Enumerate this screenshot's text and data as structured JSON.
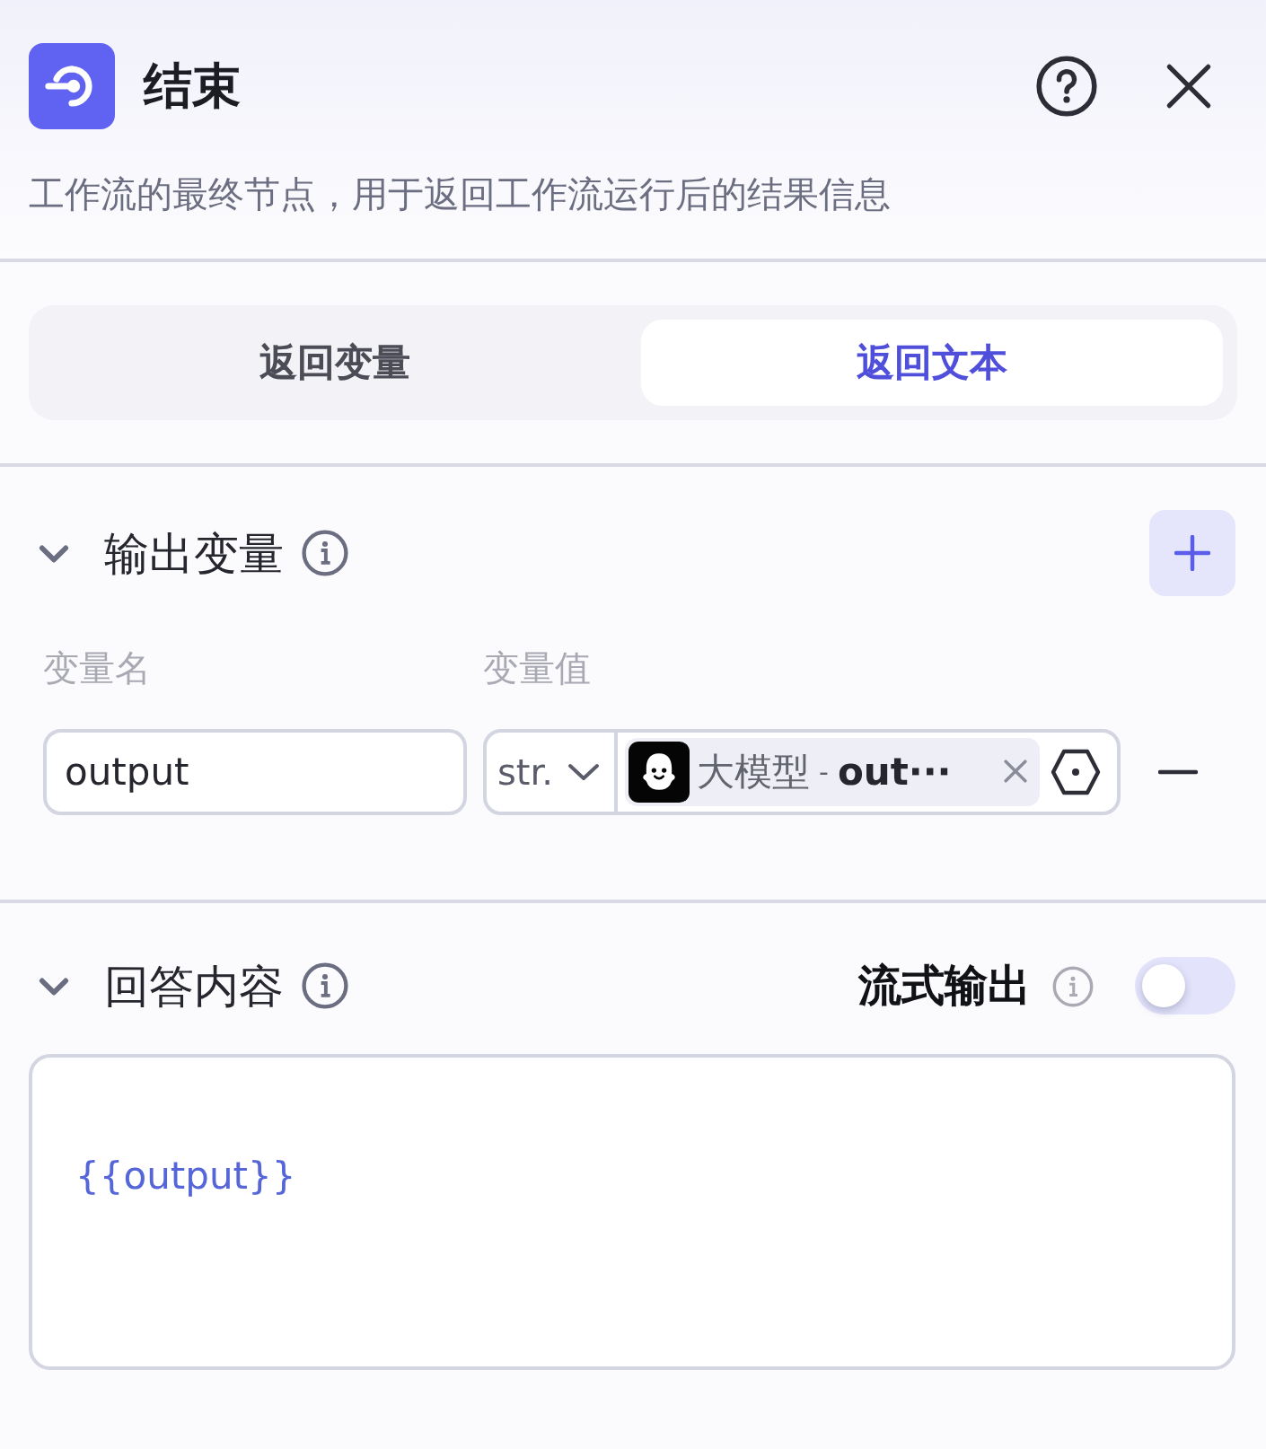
{
  "node": {
    "title": "结束",
    "description": "工作流的最终节点，用于返回工作流运行后的结果信息"
  },
  "mode_tabs": [
    {
      "label": "返回变量",
      "selected": false
    },
    {
      "label": "返回文本",
      "selected": true
    }
  ],
  "output_section": {
    "title": "输出变量",
    "expanded": true,
    "columns": [
      "变量名",
      "变量值"
    ],
    "rows": [
      {
        "name": "output",
        "type": "str.",
        "reference": {
          "source": "大模型",
          "separator": "-",
          "variable": "out···"
        }
      }
    ]
  },
  "answer_section": {
    "title": "回答内容",
    "expanded": true,
    "streaming": {
      "label": "流式输出",
      "on": false
    },
    "content": "{{output}}"
  }
}
